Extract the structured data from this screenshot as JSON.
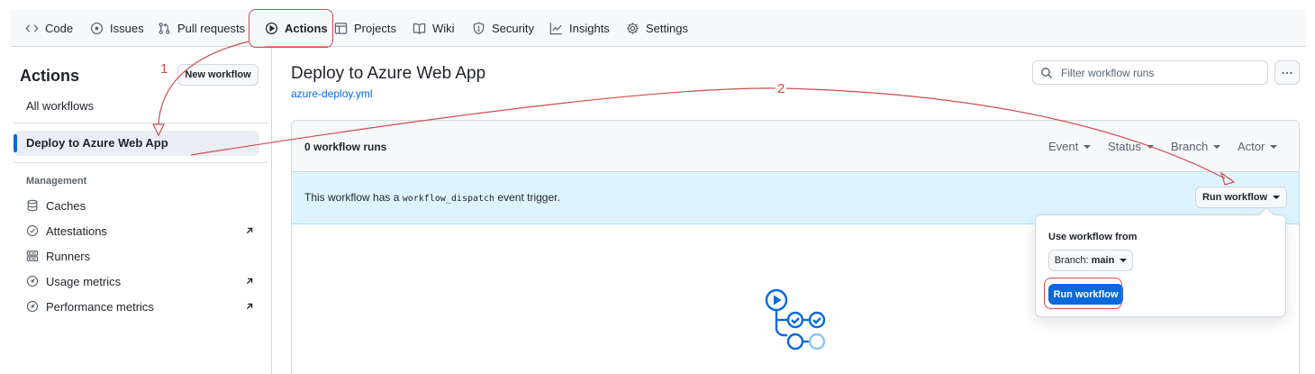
{
  "nav": {
    "tabs": [
      {
        "label": "Code",
        "icon": "code-icon"
      },
      {
        "label": "Issues",
        "icon": "issue-opened-icon"
      },
      {
        "label": "Pull requests",
        "icon": "git-pull-request-icon"
      },
      {
        "label": "Actions",
        "icon": "play-icon",
        "active": true
      },
      {
        "label": "Projects",
        "icon": "table-icon"
      },
      {
        "label": "Wiki",
        "icon": "book-icon"
      },
      {
        "label": "Security",
        "icon": "shield-icon"
      },
      {
        "label": "Insights",
        "icon": "graph-icon"
      },
      {
        "label": "Settings",
        "icon": "gear-icon"
      }
    ]
  },
  "sidebar": {
    "title": "Actions",
    "new_workflow": "New workflow",
    "all_workflows": "All workflows",
    "selected_workflow": "Deploy to Azure Web App",
    "management_heading": "Management",
    "management_items": [
      {
        "label": "Caches",
        "icon": "database-icon"
      },
      {
        "label": "Attestations",
        "icon": "verified-icon",
        "external": true
      },
      {
        "label": "Runners",
        "icon": "server-icon"
      },
      {
        "label": "Usage metrics",
        "icon": "meter-icon",
        "external": true
      },
      {
        "label": "Performance metrics",
        "icon": "meter-icon",
        "external": true
      }
    ]
  },
  "main": {
    "title": "Deploy to Azure Web App",
    "file": "azure-deploy.yml",
    "filter_placeholder": "Filter workflow runs",
    "runs_count": "0 workflow runs",
    "filters": [
      "Event",
      "Status",
      "Branch",
      "Actor"
    ],
    "dispatch_prefix": "This workflow has a",
    "dispatch_code": "workflow_dispatch",
    "dispatch_suffix": "event trigger.",
    "run_workflow_button": "Run workflow"
  },
  "popover": {
    "label": "Use workflow from",
    "branch_prefix": "Branch:",
    "branch_value": "main",
    "run_button": "Run workflow"
  },
  "annotations": {
    "step1": "1",
    "step2": "2",
    "color": "#d14b4b"
  },
  "colors": {
    "accent": "#0969da",
    "tab_underline": "#fd8c73",
    "dispatch_bg": "#ddf4ff"
  }
}
